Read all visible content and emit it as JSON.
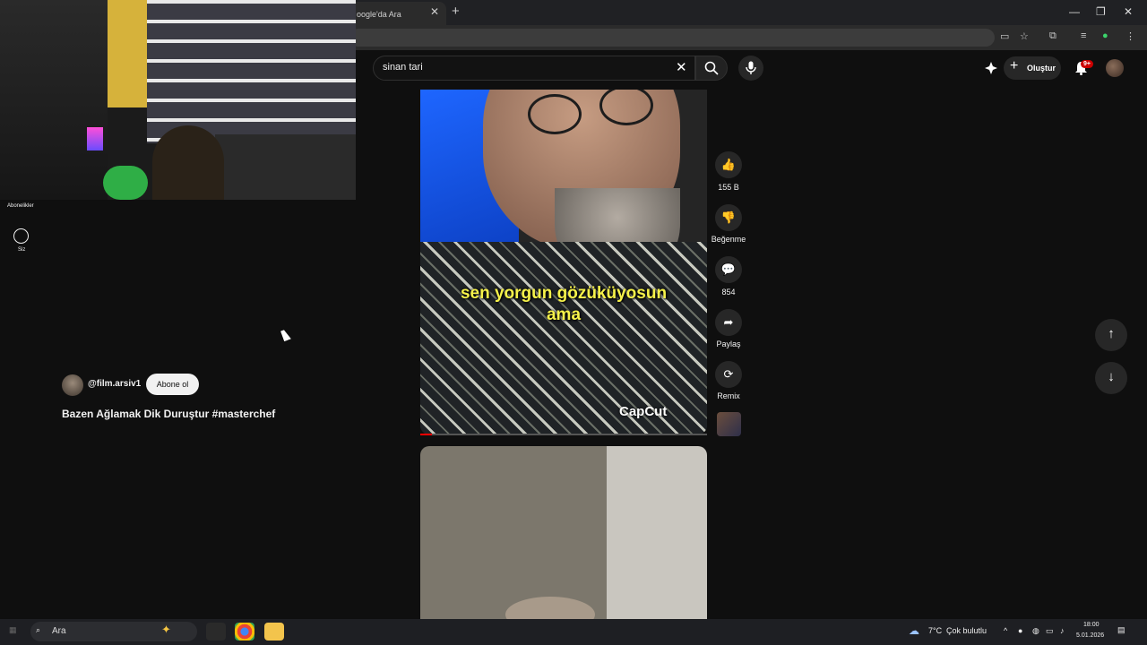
{
  "browser": {
    "tab_title": "oogle'da Ara",
    "tab_close": "✕",
    "new_tab": "+",
    "minimize": "—",
    "maximize": "❐",
    "close": "✕"
  },
  "header": {
    "search_query": "sinan tari",
    "clear": "✕",
    "search_icon": "⌕",
    "mic_icon": "🎤",
    "create_label": "Oluştur",
    "create_plus": "+",
    "notifications_badge": "9+",
    "bell_icon": "🔔"
  },
  "sidebar": {
    "subscriptions_label": "Abonelikler",
    "you_label": "Siz"
  },
  "short": {
    "channel_handle": "@film.arsiv1",
    "subscribe_label": "Abone ol",
    "title": "Bazen Ağlamak Dik Duruştur #masterchef",
    "caption_line1": "sen yorgun gözüküyosun",
    "caption_line2": "ama",
    "watermark": "CapCut",
    "progress": 0.04
  },
  "actions": {
    "like_count": "155 B",
    "dislike_label": "Beğenme",
    "comment_count": "854",
    "share_label": "Paylaş",
    "remix_label": "Remix",
    "like_icon": "👍",
    "dislike_icon": "👎",
    "comment_icon": "💬",
    "share_icon": "➦",
    "remix_icon": "⟳"
  },
  "navigation": {
    "up": "↑",
    "down": "↓"
  },
  "taskbar": {
    "search_placeholder": "Ara",
    "search_icon": "⌕",
    "weather_temp": "7°C",
    "weather_desc": "Çok bulutlu",
    "time": "18:00",
    "date": "5.01.2026"
  }
}
